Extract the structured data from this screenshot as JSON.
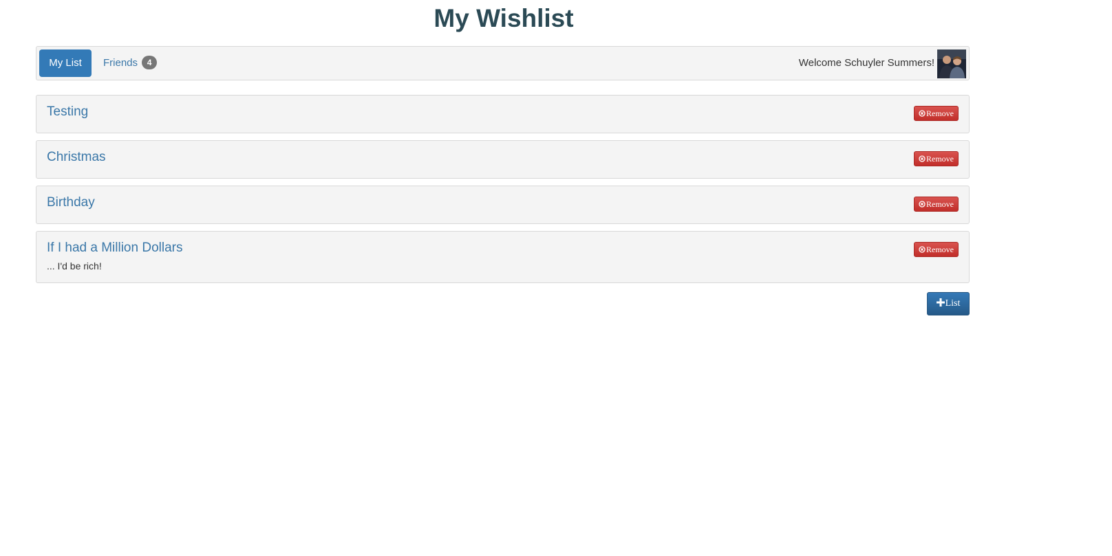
{
  "header": {
    "title": "My Wishlist"
  },
  "nav": {
    "tabs": [
      {
        "label": "My List",
        "active": true
      },
      {
        "label": "Friends",
        "badge": "4",
        "active": false
      }
    ],
    "welcome": "Welcome Schuyler Summers!",
    "avatar_icon": "user-avatar-photo"
  },
  "lists": [
    {
      "title": "Testing",
      "description": "",
      "remove_label": "Remove"
    },
    {
      "title": "Christmas",
      "description": "",
      "remove_label": "Remove"
    },
    {
      "title": "Birthday",
      "description": "",
      "remove_label": "Remove"
    },
    {
      "title": "If I had a Million Dollars",
      "description": "... I'd be rich!",
      "remove_label": "Remove"
    }
  ],
  "actions": {
    "add_list_label": "List",
    "add_icon": "plus-icon",
    "remove_icon": "remove-circle-icon"
  },
  "colors": {
    "primary": "#337ab7",
    "danger": "#d9534f",
    "title": "#2b4a55",
    "link": "#3a77a8"
  }
}
